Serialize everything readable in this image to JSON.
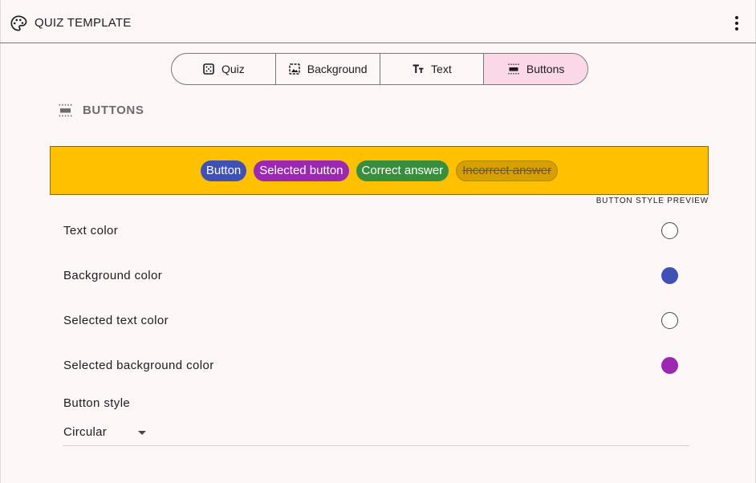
{
  "appbar": {
    "title": "QUIZ TEMPLATE",
    "icon": "palette-icon",
    "menu_icon": "more-vert-icon"
  },
  "tabs": [
    {
      "label": "Quiz",
      "icon": "quiz-icon",
      "active": false
    },
    {
      "label": "Background",
      "icon": "image-icon",
      "active": false
    },
    {
      "label": "Text",
      "icon": "text-fields-icon",
      "active": false
    },
    {
      "label": "Buttons",
      "icon": "buttons-icon",
      "active": true
    }
  ],
  "section": {
    "title": "BUTTONS",
    "icon": "buttons-icon"
  },
  "preview": {
    "background": "#ffc000",
    "buttons": [
      {
        "label": "Button",
        "state": "normal"
      },
      {
        "label": "Selected button",
        "state": "selected"
      },
      {
        "label": "Correct answer",
        "state": "correct"
      },
      {
        "label": "Incorrect answer",
        "state": "incorrect"
      }
    ],
    "caption": "BUTTON STYLE PREVIEW"
  },
  "colors": [
    {
      "label": "Text color",
      "value": "#ffffff"
    },
    {
      "label": "Background color",
      "value": "#3f51b5"
    },
    {
      "label": "Selected text color",
      "value": "#ffffff"
    },
    {
      "label": "Selected background color",
      "value": "#9c27b0"
    }
  ],
  "button_style": {
    "label": "Button style",
    "value": "Circular"
  }
}
